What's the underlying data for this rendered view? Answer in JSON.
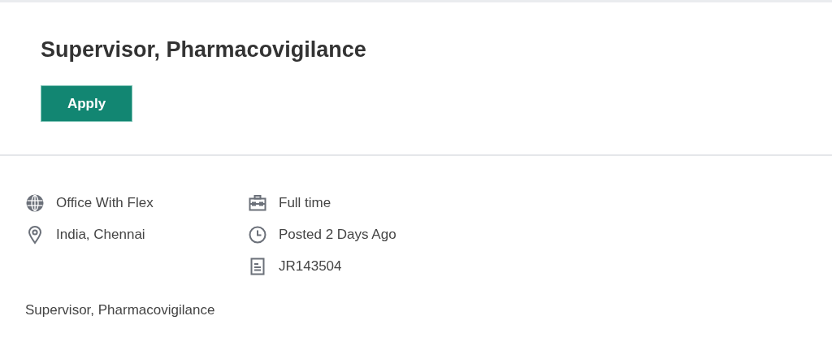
{
  "job": {
    "title": "Supervisor, Pharmacovigilance",
    "apply_button": "Apply"
  },
  "details_left": [
    {
      "kind": "work_mode",
      "text": "Office With Flex"
    },
    {
      "kind": "location",
      "text": "India, Chennai"
    }
  ],
  "details_right": [
    {
      "kind": "job_type",
      "text": "Full time"
    },
    {
      "kind": "posted",
      "text": "Posted 2 Days Ago"
    },
    {
      "kind": "requisition",
      "text": "JR143504"
    }
  ],
  "description": "Supervisor, Pharmacovigilance"
}
